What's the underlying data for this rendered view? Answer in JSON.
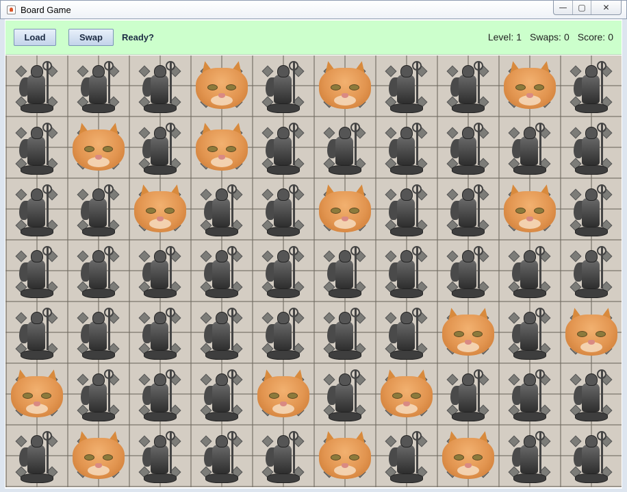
{
  "window": {
    "title": "Board Game",
    "controls": [
      "—",
      "▢",
      "✕"
    ]
  },
  "toolbar": {
    "load_label": "Load",
    "swap_label": "Swap",
    "status": "Ready?",
    "level_label": "Level:",
    "level_value": "1",
    "swaps_label": "Swaps:",
    "swaps_value": "0",
    "score_label": "Score:",
    "score_value": "0"
  },
  "board": {
    "rows": 7,
    "cols": 10,
    "pieces": [
      [
        "figurine",
        "figurine",
        "figurine",
        "cat",
        "figurine",
        "cat",
        "figurine",
        "figurine",
        "cat",
        "figurine"
      ],
      [
        "figurine",
        "cat",
        "figurine",
        "cat",
        "figurine",
        "figurine",
        "figurine",
        "figurine",
        "figurine",
        "figurine"
      ],
      [
        "figurine",
        "figurine",
        "cat",
        "figurine",
        "figurine",
        "cat",
        "figurine",
        "figurine",
        "cat",
        "figurine"
      ],
      [
        "figurine",
        "figurine",
        "figurine",
        "figurine",
        "figurine",
        "figurine",
        "figurine",
        "figurine",
        "figurine",
        "figurine"
      ],
      [
        "figurine",
        "figurine",
        "figurine",
        "figurine",
        "figurine",
        "figurine",
        "figurine",
        "cat",
        "figurine",
        "cat"
      ],
      [
        "cat",
        "figurine",
        "figurine",
        "figurine",
        "cat",
        "figurine",
        "cat",
        "figurine",
        "figurine",
        "figurine"
      ],
      [
        "figurine",
        "cat",
        "figurine",
        "figurine",
        "figurine",
        "cat",
        "figurine",
        "cat",
        "figurine",
        "figurine"
      ]
    ]
  }
}
